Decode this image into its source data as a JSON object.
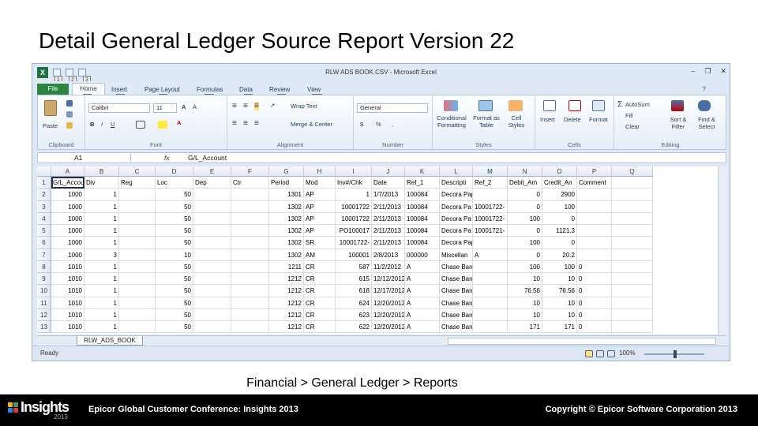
{
  "slide": {
    "title": "Detail General Ledger Source Report Version 22",
    "caption": "Financial > General Ledger > Reports"
  },
  "footer": {
    "logo_text": "Insights",
    "logo_year": "2013",
    "conference": "Epicor Global Customer Conference: Insights 2013",
    "copyright": "Copyright © Epicor Software Corporation 2013"
  },
  "excel": {
    "window_title": "RLW ADS BOOK.CSV - Microsoft Excel",
    "qat_keytips": [
      "1",
      "2",
      "3"
    ],
    "tabs": [
      {
        "label": "File",
        "key": "F"
      },
      {
        "label": "Home",
        "key": "H"
      },
      {
        "label": "Insert",
        "key": "N"
      },
      {
        "label": "Page Layout",
        "key": "P"
      },
      {
        "label": "Formulas",
        "key": "M"
      },
      {
        "label": "Data",
        "key": "A"
      },
      {
        "label": "Review",
        "key": "R"
      },
      {
        "label": "View",
        "key": "W"
      }
    ],
    "ribbon": {
      "clipboard": {
        "label": "Clipboard",
        "paste": "Paste"
      },
      "font": {
        "label": "Font",
        "name": "Calibri",
        "size": "11"
      },
      "alignment": {
        "label": "Alignment",
        "wrap_text": "Wrap Text",
        "merge_center": "Merge & Center"
      },
      "number": {
        "label": "Number",
        "format": "General",
        "currency": "$",
        "percent": "%"
      },
      "styles": {
        "label": "Styles",
        "conditional_formatting": "Conditional Formatting",
        "format_as_table": "Format as Table",
        "cell_styles": "Cell Styles"
      },
      "cells": {
        "label": "Cells",
        "insert": "Insert",
        "delete": "Delete",
        "format": "Format"
      },
      "editing": {
        "label": "Editing",
        "autosum": "AutoSum",
        "fill": "Fill",
        "clear": "Clear",
        "sort_filter": "Sort & Filter",
        "find_select": "Find & Select"
      }
    },
    "name_box": "A1",
    "fx_label": "fx",
    "formula": "G/L_Account",
    "columns": [
      "A",
      "B",
      "C",
      "D",
      "E",
      "F",
      "G",
      "H",
      "I",
      "J",
      "K",
      "L",
      "M",
      "N",
      "O",
      "P",
      "Q"
    ],
    "rows": [
      [
        "1",
        "G/L_Accou",
        "Div",
        "Reg",
        "Loc",
        "Dep",
        "Ctr",
        "Period",
        "Mod",
        "Inv#/Chk",
        "Date",
        "Ref_1",
        "Descripti",
        "Ref_2",
        "Debit_Am",
        "Credit_An",
        "Comment",
        ""
      ],
      [
        "2",
        "1000",
        "1",
        "",
        "50",
        "",
        "",
        "1301",
        "AP",
        "1",
        "1/7/2013",
        "100084",
        "Decora Paper",
        "",
        "0",
        "2900",
        "",
        ""
      ],
      [
        "3",
        "1000",
        "1",
        "",
        "50",
        "",
        "",
        "1302",
        "AP",
        "10001722",
        "2/11/2013",
        "100084",
        "Decora Pa",
        "10001722-",
        "0",
        "100",
        "",
        ""
      ],
      [
        "4",
        "1000",
        "1",
        "",
        "50",
        "",
        "",
        "1302",
        "AP",
        "10001722",
        "2/11/2013",
        "100084",
        "Decora Pa",
        "10001722-",
        "100",
        "0",
        "",
        ""
      ],
      [
        "5",
        "1000",
        "1",
        "",
        "50",
        "",
        "",
        "1302",
        "AP",
        "PO100017",
        "2/11/2013",
        "100084",
        "Decora Pa",
        "10001721-",
        "0",
        "1121.3",
        "",
        ""
      ],
      [
        "6",
        "1000",
        "1",
        "",
        "50",
        "",
        "",
        "1302",
        "SR",
        "10001722-",
        "2/11/2013",
        "100084",
        "Decora Paper",
        "",
        "100",
        "0",
        "",
        ""
      ],
      [
        "7",
        "1000",
        "3",
        "",
        "10",
        "",
        "",
        "1302",
        "AM",
        "100001",
        "2/8/2013",
        "000000",
        "Miscellan",
        "A",
        "0",
        "20.2",
        "",
        ""
      ],
      [
        "8",
        "1010",
        "1",
        "",
        "50",
        "",
        "",
        "1211",
        "CR",
        "587",
        "11/2/2012",
        "A",
        "Chase Ban",
        "",
        "100",
        "100",
        "0",
        ""
      ],
      [
        "9",
        "1010",
        "1",
        "",
        "50",
        "",
        "",
        "1212",
        "CR",
        "615",
        "12/12/2012",
        "A",
        "Chase Ban",
        "",
        "10",
        "10",
        "0",
        ""
      ],
      [
        "10",
        "1010",
        "1",
        "",
        "50",
        "",
        "",
        "1212",
        "CR",
        "618",
        "12/17/2012",
        "A",
        "Chase Ban",
        "",
        "76.56",
        "76.56",
        "0",
        ""
      ],
      [
        "11",
        "1010",
        "1",
        "",
        "50",
        "",
        "",
        "1212",
        "CR",
        "624",
        "12/20/2012",
        "A",
        "Chase Ban",
        "",
        "10",
        "10",
        "0",
        ""
      ],
      [
        "12",
        "1010",
        "1",
        "",
        "50",
        "",
        "",
        "1212",
        "CR",
        "623",
        "12/20/2012",
        "A",
        "Chase Ban",
        "",
        "10",
        "10",
        "0",
        ""
      ],
      [
        "13",
        "1010",
        "1",
        "",
        "50",
        "",
        "",
        "1212",
        "CR",
        "622",
        "12/20/2012",
        "A",
        "Chase Ban",
        "",
        "171",
        "171",
        "0",
        ""
      ]
    ],
    "sheet_tab": "RLW_ADS_BOOK",
    "status": "Ready",
    "zoom": "100%"
  }
}
